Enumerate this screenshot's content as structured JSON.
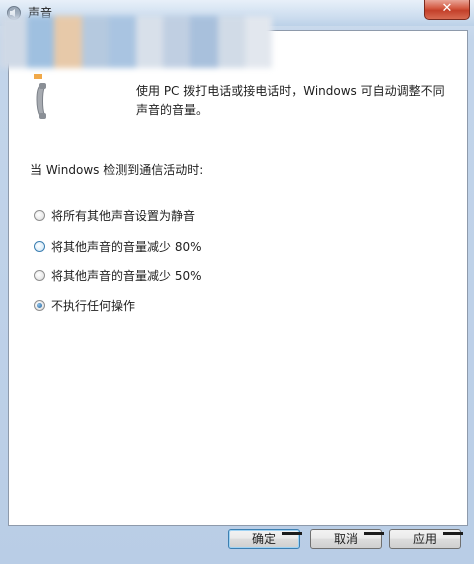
{
  "window": {
    "title": "声音",
    "close_label": "✕"
  },
  "colors": {
    "frame": "#c3d5ea",
    "panel": "#ffffff",
    "accent": "#3c7fb1",
    "close": "#c3402a"
  },
  "icons": {
    "title": "speaker-icon",
    "phone": "telephone-handset-icon"
  },
  "communications": {
    "description": "使用 PC 拨打电话或接电话时，Windows 可自动调整不同声音的音量。",
    "section_label": "当 Windows 检测到通信活动时:",
    "options": [
      {
        "label": "将所有其他声音设置为静音",
        "selected": false
      },
      {
        "label": "将其他声音的音量减少 80%",
        "selected": false
      },
      {
        "label": "将其他声音的音量减少 50%",
        "selected": false
      },
      {
        "label": "不执行任何操作",
        "selected": true
      }
    ]
  },
  "buttons": {
    "ok": "确定",
    "cancel": "取消",
    "apply": "应用"
  }
}
